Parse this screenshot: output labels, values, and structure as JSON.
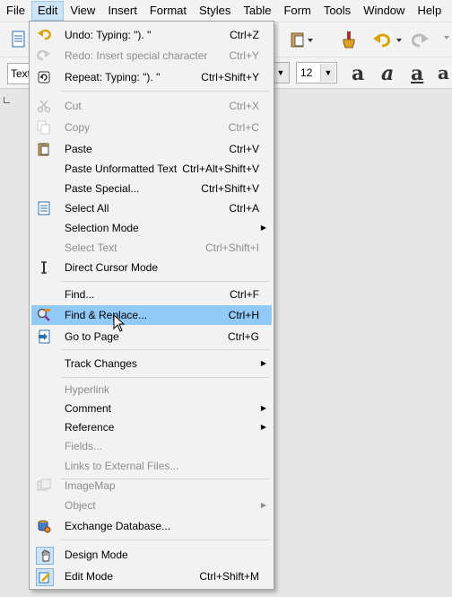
{
  "menubar": [
    {
      "label": "File",
      "active": false
    },
    {
      "label": "Edit",
      "active": true
    },
    {
      "label": "View",
      "active": false
    },
    {
      "label": "Insert",
      "active": false
    },
    {
      "label": "Format",
      "active": false
    },
    {
      "label": "Styles",
      "active": false
    },
    {
      "label": "Table",
      "active": false
    },
    {
      "label": "Form",
      "active": false
    },
    {
      "label": "Tools",
      "active": false
    },
    {
      "label": "Window",
      "active": false
    },
    {
      "label": "Help",
      "active": false
    }
  ],
  "toolbar": {
    "paragraph_style": "Text",
    "font_size": "12"
  },
  "edit_menu": {
    "items": [
      {
        "label": "Undo: Typing: \"). \"",
        "shortcut": "Ctrl+Z",
        "icon": "undo-icon",
        "enabled": true
      },
      {
        "label": "Redo: Insert special character",
        "shortcut": "Ctrl+Y",
        "icon": "redo-icon",
        "enabled": false
      },
      {
        "label": "Repeat: Typing: \"). \"",
        "shortcut": "Ctrl+Shift+Y",
        "icon": "repeat-icon",
        "enabled": true
      },
      {
        "label": "Cut",
        "shortcut": "Ctrl+X",
        "icon": "cut-icon",
        "enabled": false
      },
      {
        "label": "Copy",
        "shortcut": "Ctrl+C",
        "icon": "copy-icon",
        "enabled": false
      },
      {
        "label": "Paste",
        "shortcut": "Ctrl+V",
        "icon": "paste-icon",
        "enabled": true
      },
      {
        "label": "Paste Unformatted Text",
        "shortcut": "Ctrl+Alt+Shift+V",
        "icon": "",
        "enabled": true
      },
      {
        "label": "Paste Special...",
        "shortcut": "Ctrl+Shift+V",
        "icon": "",
        "enabled": true
      },
      {
        "label": "Select All",
        "shortcut": "Ctrl+A",
        "icon": "select-all-icon",
        "enabled": true
      },
      {
        "label": "Selection Mode",
        "shortcut": "",
        "icon": "",
        "enabled": true,
        "submenu": true
      },
      {
        "label": "Select Text",
        "shortcut": "Ctrl+Shift+I",
        "icon": "",
        "enabled": false
      },
      {
        "label": "Direct Cursor Mode",
        "shortcut": "",
        "icon": "text-cursor-icon",
        "enabled": true
      },
      {
        "label": "Find...",
        "shortcut": "Ctrl+F",
        "icon": "",
        "enabled": true
      },
      {
        "label": "Find & Replace...",
        "shortcut": "Ctrl+H",
        "icon": "find-replace-icon",
        "enabled": true,
        "highlighted": true
      },
      {
        "label": "Go to Page",
        "shortcut": "Ctrl+G",
        "icon": "goto-page-icon",
        "enabled": true
      },
      {
        "label": "Track Changes",
        "shortcut": "",
        "icon": "",
        "enabled": true,
        "submenu": true
      },
      {
        "label": "Hyperlink",
        "shortcut": "",
        "icon": "",
        "enabled": false
      },
      {
        "label": "Comment",
        "shortcut": "",
        "icon": "",
        "enabled": true,
        "submenu": true
      },
      {
        "label": "Reference",
        "shortcut": "",
        "icon": "",
        "enabled": true,
        "submenu": true
      },
      {
        "label": "Fields...",
        "shortcut": "",
        "icon": "",
        "enabled": false
      },
      {
        "label": "Links to External Files...",
        "shortcut": "",
        "icon": "",
        "enabled": false
      },
      {
        "label": "ImageMap",
        "shortcut": "",
        "icon": "imagemap-icon",
        "enabled": false
      },
      {
        "label": "Object",
        "shortcut": "",
        "icon": "",
        "enabled": false,
        "submenu": true
      },
      {
        "label": "Exchange Database...",
        "shortcut": "",
        "icon": "database-icon",
        "enabled": true
      },
      {
        "label": "Design Mode",
        "shortcut": "",
        "icon": "design-mode-icon",
        "enabled": true
      },
      {
        "label": "Edit Mode",
        "shortcut": "Ctrl+Shift+M",
        "icon": "edit-mode-icon",
        "enabled": true
      }
    ]
  },
  "colors": {
    "highlight": "#91c9f7",
    "menu_bg": "#f2f2f2",
    "disabled": "#8d8d8d"
  }
}
